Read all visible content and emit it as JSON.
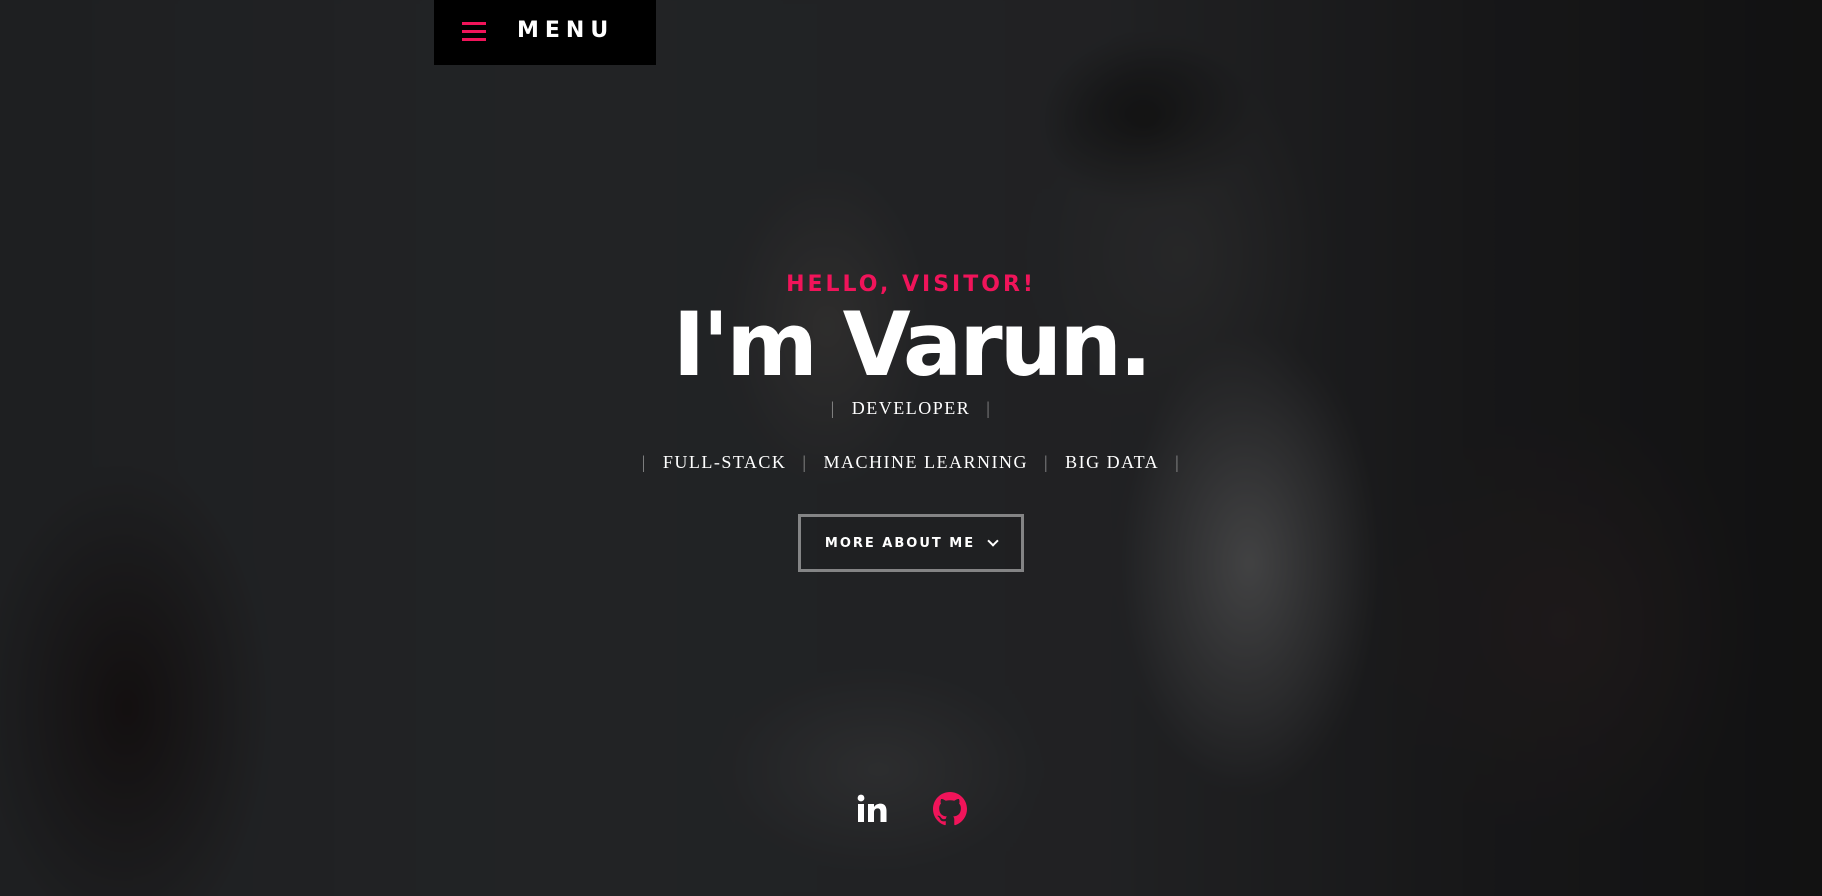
{
  "menu": {
    "label": "MENU",
    "icon": "hamburger-icon",
    "icon_color": "#f0145a"
  },
  "hero": {
    "greeting": "HELLO, VISITOR!",
    "name": "I'm Varun.",
    "role": "DEVELOPER",
    "skills": [
      "FULL-STACK",
      "MACHINE LEARNING",
      "BIG DATA"
    ],
    "separator": "|",
    "cta_label": "MORE ABOUT ME",
    "cta_icon": "chevron-down-icon"
  },
  "social": [
    {
      "icon": "linkedin-icon",
      "color": "#ffffff"
    },
    {
      "icon": "github-icon",
      "color": "#f0145a"
    }
  ],
  "colors": {
    "accent": "#f0145a",
    "text": "#ffffff",
    "menu_bg": "#000000"
  }
}
